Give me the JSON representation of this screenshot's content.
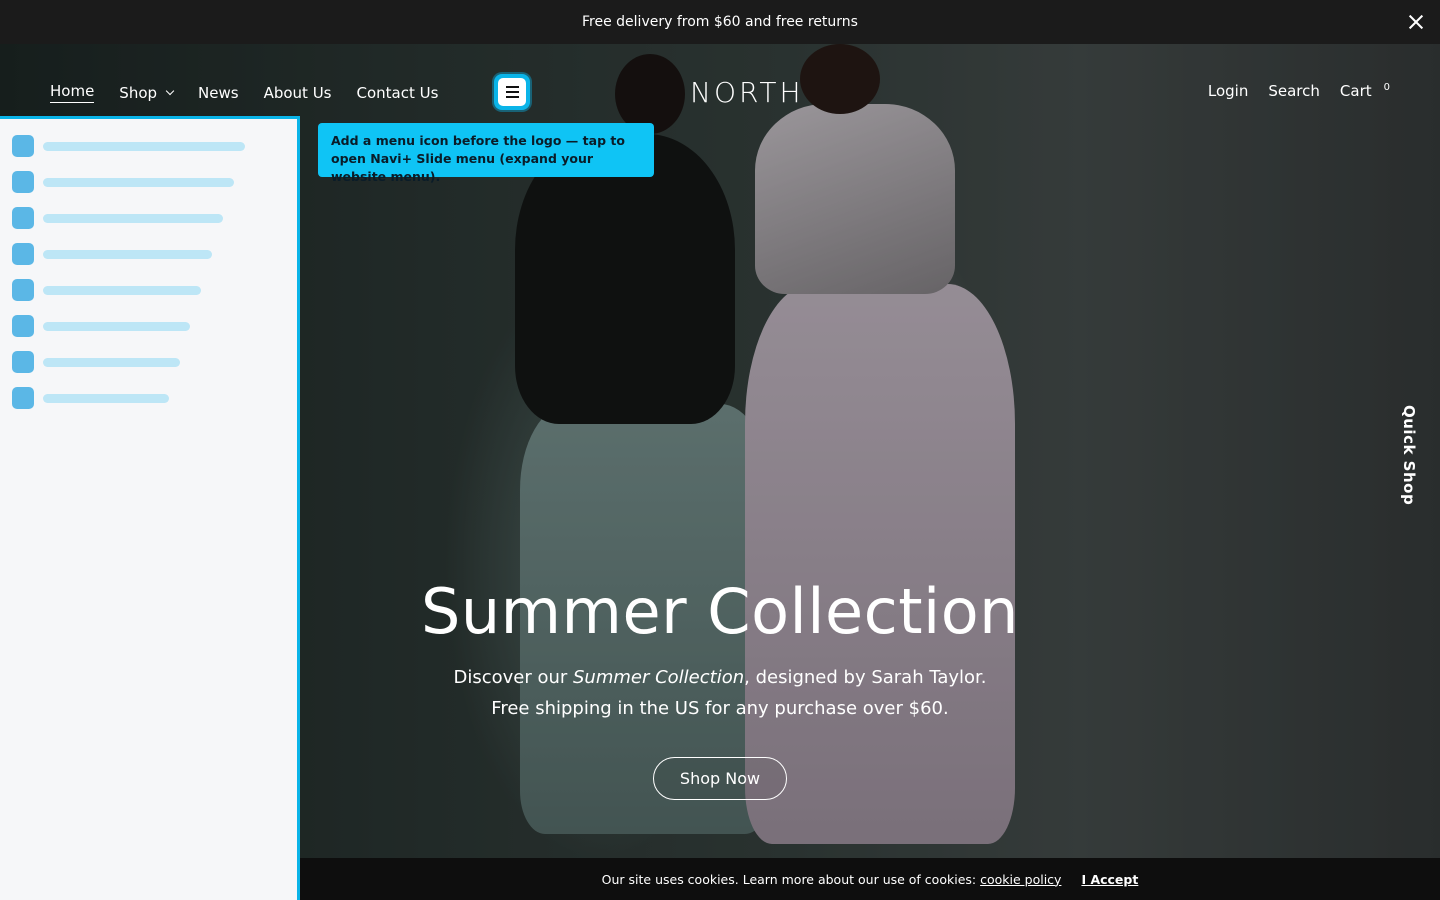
{
  "announcement": {
    "text": "Free delivery from $60 and free returns"
  },
  "nav": {
    "items": [
      {
        "label": "Home"
      },
      {
        "label": "Shop"
      },
      {
        "label": "News"
      },
      {
        "label": "About Us"
      },
      {
        "label": "Contact Us"
      }
    ],
    "logo": "NORTH",
    "right": {
      "login": "Login",
      "search": "Search",
      "cart": "Cart",
      "cart_count": "0"
    }
  },
  "tooltip": {
    "text": "Add a menu icon before the logo — tap to open Navi+ Slide menu (expand your website menu)."
  },
  "hero": {
    "title": "Summer Collection",
    "subtitle_prefix": "Discover our ",
    "subtitle_emph": "Summer Collection",
    "subtitle_suffix": ", designed by Sarah Taylor.",
    "subtitle_line2": "Free shipping in the US for any purchase over $60.",
    "cta": "Shop Now"
  },
  "quick_shop": {
    "label": "Quick Shop"
  },
  "cookie": {
    "text": "Our site uses cookies. Learn more about our use of cookies:",
    "link": "cookie policy",
    "accept": "I Accept"
  },
  "colors": {
    "accent": "#0ab4e8",
    "tooltip_bg": "#0fc4f5",
    "panel_bg": "#f6f7f9",
    "skeleton_square": "#5bb7e6",
    "skeleton_bar": "#bde6f6",
    "announcement_bg": "#1b1b1b"
  },
  "icons": {
    "close": "close-icon",
    "menu": "hamburger-menu-icon",
    "chevron": "chevron-down-icon"
  }
}
